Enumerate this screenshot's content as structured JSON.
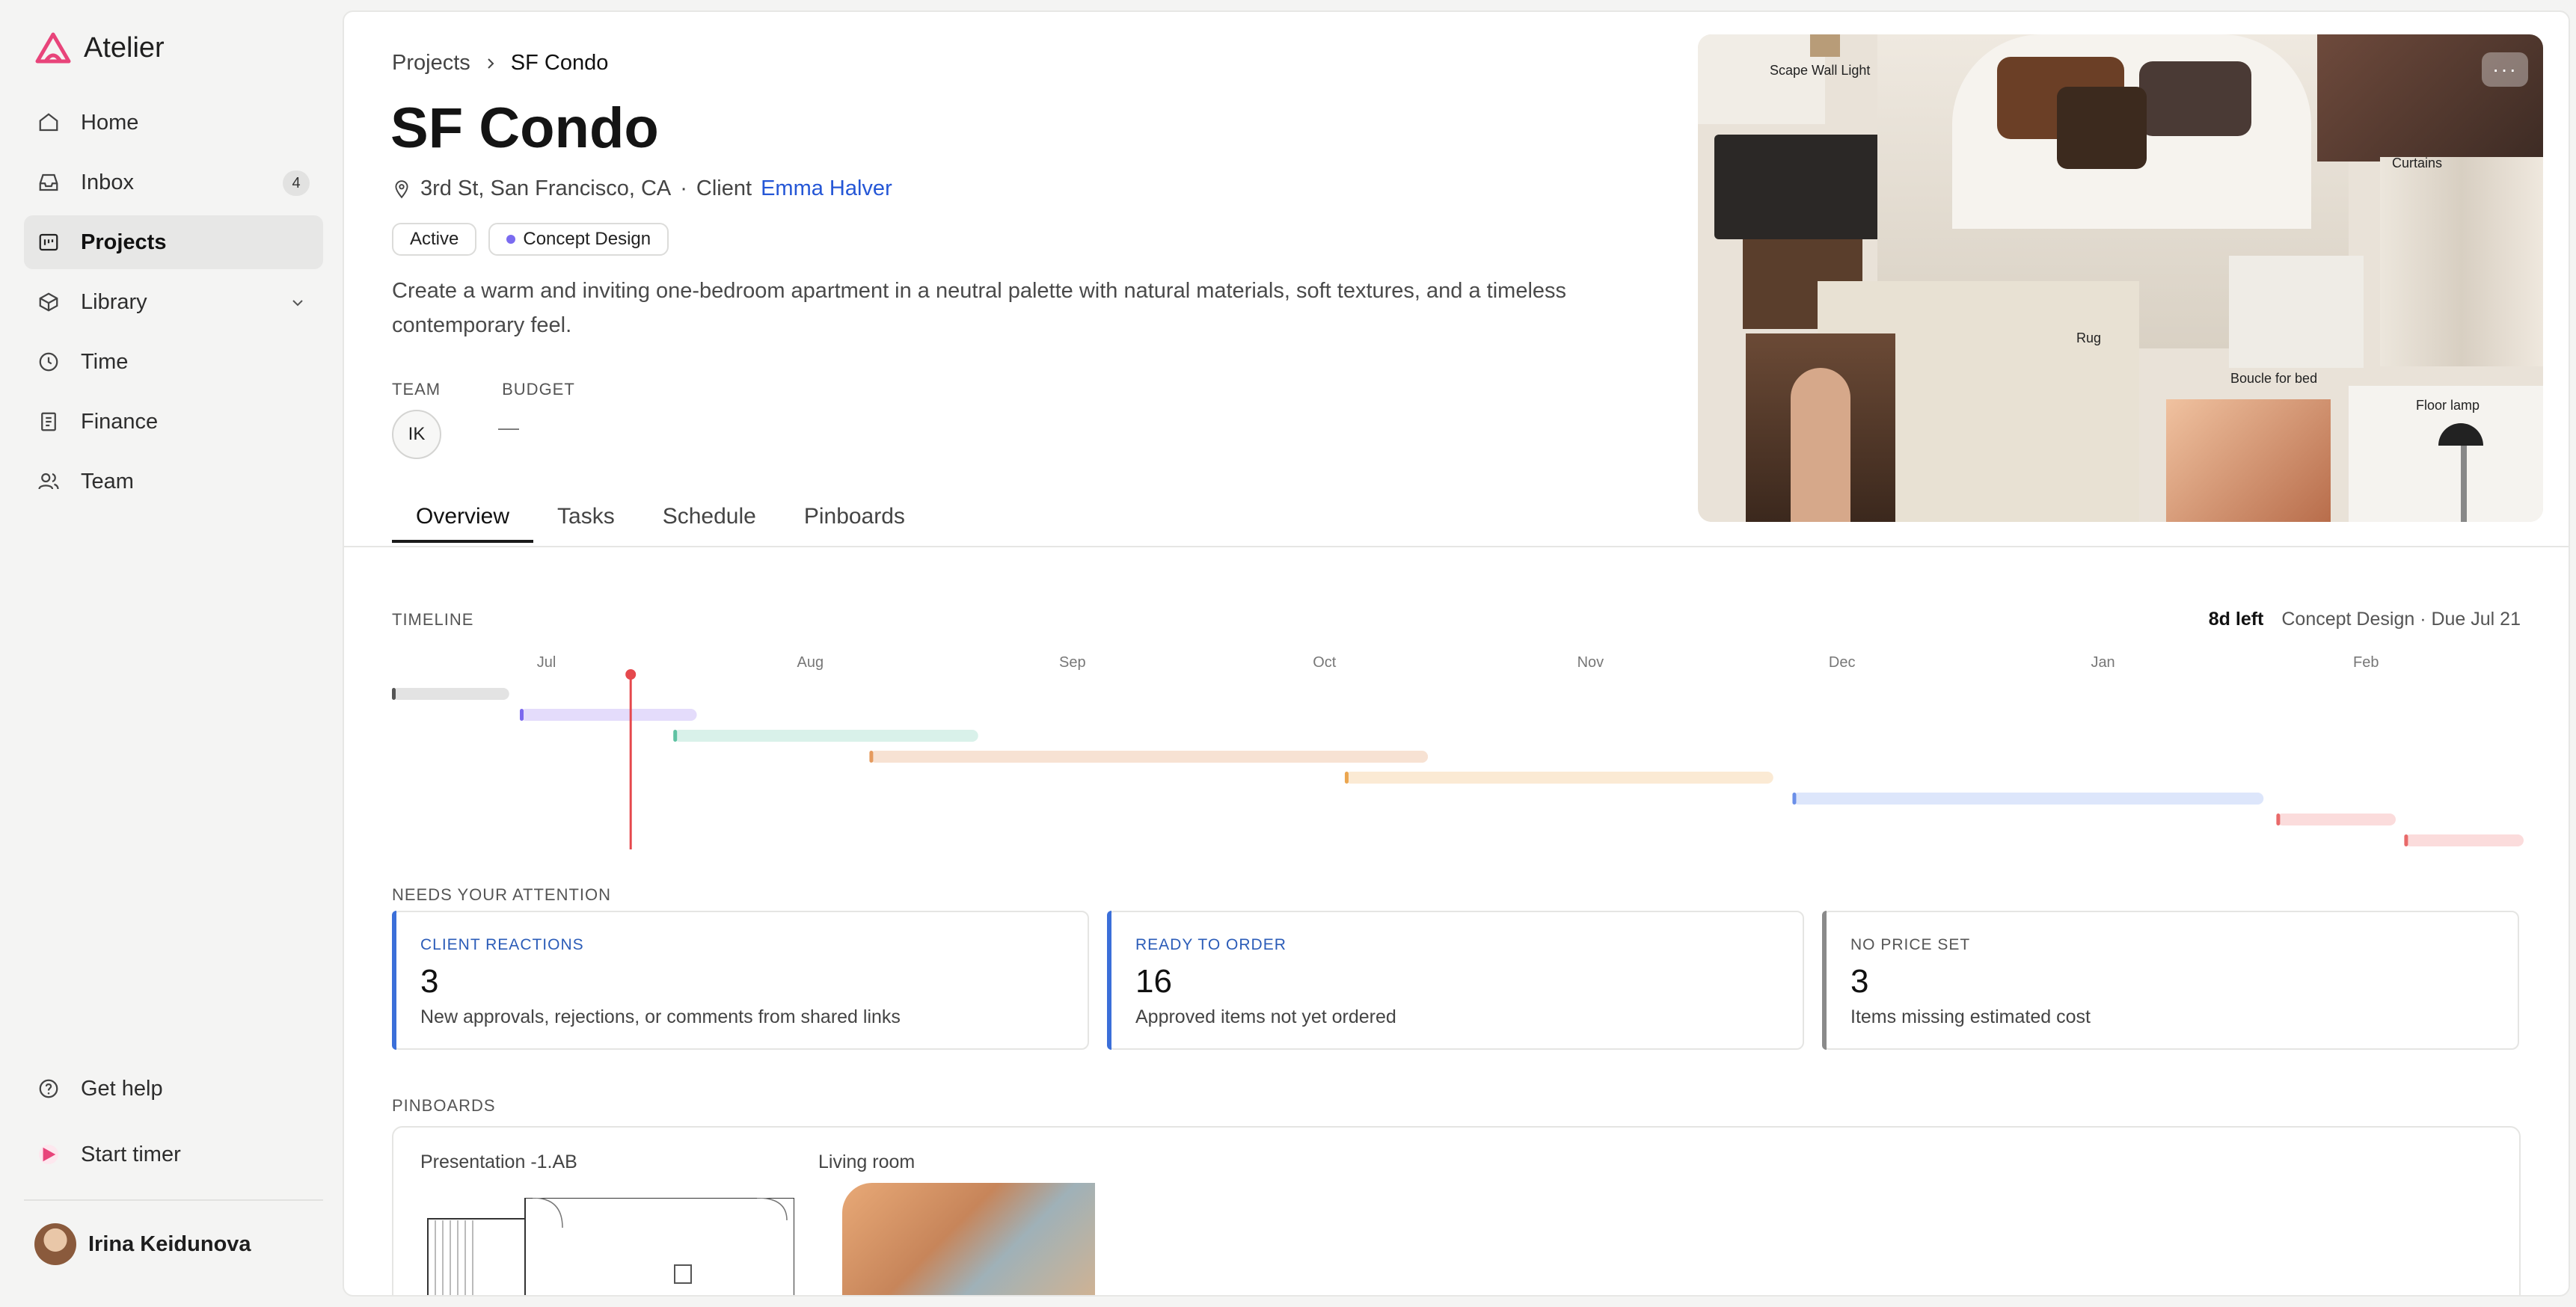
{
  "app": {
    "name": "Atelier",
    "brand_color": "#e8447a"
  },
  "sidebar": {
    "items": [
      {
        "label": "Home",
        "icon": "home-icon"
      },
      {
        "label": "Inbox",
        "icon": "inbox-icon",
        "badge": "4"
      },
      {
        "label": "Projects",
        "icon": "projects-icon",
        "active": true
      },
      {
        "label": "Library",
        "icon": "library-icon",
        "expandable": true
      },
      {
        "label": "Time",
        "icon": "clock-icon"
      },
      {
        "label": "Finance",
        "icon": "finance-icon"
      },
      {
        "label": "Team",
        "icon": "team-icon"
      }
    ],
    "help_label": "Get help",
    "timer_label": "Start timer",
    "user_name": "Irina Keidunova"
  },
  "breadcrumb": {
    "parent": "Projects",
    "current": "SF Condo"
  },
  "project": {
    "title": "SF Condo",
    "address": "3rd St, San Francisco, CA",
    "separator": "·",
    "client_label": "Client",
    "client_name": "Emma Halver",
    "status": "Active",
    "phase": "Concept Design",
    "description": "Create a warm and inviting one-bedroom apartment in a neutral palette with natural materials, soft textures, and a timeless contemporary feel.",
    "team_label": "TEAM",
    "budget_label": "BUDGET",
    "team_initials": "IK",
    "budget_value": "—"
  },
  "tabs": [
    "Overview",
    "Tasks",
    "Schedule",
    "Pinboards"
  ],
  "moodboard": {
    "labels": [
      "Scape Wall Light",
      "Curtains",
      "Rug",
      "Boucle for bed",
      "Floor lamp"
    ],
    "more": "···"
  },
  "timeline": {
    "label": "TIMELINE",
    "days_left": "8d left",
    "phase_due": "Concept Design · Due Jul 21",
    "months": [
      "Jul",
      "Aug",
      "Sep",
      "Oct",
      "Nov",
      "Dec",
      "Jan",
      "Feb"
    ],
    "today_color": "#e5484d",
    "bars": [
      {
        "row": 0,
        "start": 0.0,
        "end": 0.055,
        "color": "#e3e3e3",
        "cap": "#555555"
      },
      {
        "row": 1,
        "start": 0.06,
        "end": 0.143,
        "color": "#e4dcfb",
        "cap": "#7b68ee"
      },
      {
        "row": 2,
        "start": 0.132,
        "end": 0.275,
        "color": "#d9f1ea",
        "cap": "#5fc2a3"
      },
      {
        "row": 3,
        "start": 0.224,
        "end": 0.486,
        "color": "#f7e2d3",
        "cap": "#e59b5f"
      },
      {
        "row": 4,
        "start": 0.447,
        "end": 0.648,
        "color": "#fbead4",
        "cap": "#eba650"
      },
      {
        "row": 5,
        "start": 0.657,
        "end": 0.878,
        "color": "#dde6fb",
        "cap": "#6b8fe8"
      },
      {
        "row": 6,
        "start": 0.884,
        "end": 0.94,
        "color": "#fbdcdc",
        "cap": "#e86a6a"
      },
      {
        "row": 7,
        "start": 0.944,
        "end": 1.0,
        "color": "#fbdcdc",
        "cap": "#e86a6a"
      }
    ],
    "today": 0.112
  },
  "attention": {
    "label": "NEEDS YOUR ATTENTION",
    "cards": [
      {
        "title": "CLIENT REACTIONS",
        "count": "3",
        "desc": "New approvals, rejections, or comments from shared links",
        "color": "#3b6fd9",
        "title_color": "#2b5cb8"
      },
      {
        "title": "READY TO ORDER",
        "count": "16",
        "desc": "Approved items not yet ordered",
        "color": "#3b6fd9",
        "title_color": "#2b5cb8"
      },
      {
        "title": "NO PRICE SET",
        "count": "3",
        "desc": "Items missing estimated cost",
        "color": "#8a8a8a",
        "title_color": "#555555"
      }
    ]
  },
  "pinboards": {
    "label": "PINBOARDS",
    "items": [
      "Presentation -1.AB",
      "Living room"
    ]
  }
}
